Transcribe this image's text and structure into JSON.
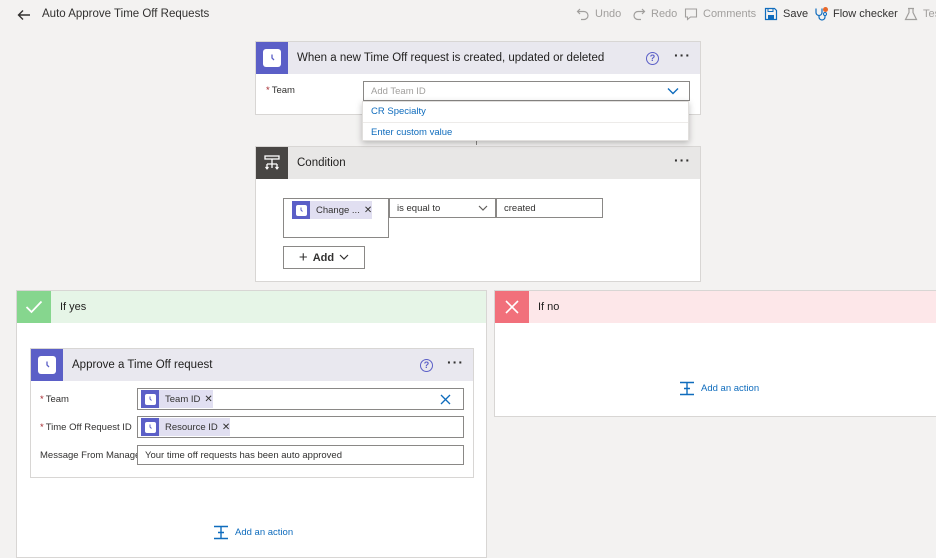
{
  "topbar": {
    "title": "Auto Approve Time Off Requests",
    "undo": "Undo",
    "redo": "Redo",
    "comments": "Comments",
    "save": "Save",
    "flow_checker": "Flow checker",
    "test": "Tes"
  },
  "trigger": {
    "title": "When a new Time Off request is created, updated or deleted",
    "team_label": "Team",
    "team_placeholder": "Add Team ID",
    "dropdown_options": [
      "CR Specialty",
      "Enter custom value"
    ]
  },
  "condition": {
    "title": "Condition",
    "left_token": "Change ...",
    "operator": "is equal to",
    "value": "created",
    "add_label": "Add"
  },
  "branch_yes": {
    "title": "If yes",
    "action": {
      "title": "Approve a Time Off request",
      "team_label": "Team",
      "team_token": "Team ID",
      "request_label": "Time Off Request ID",
      "request_token": "Resource ID",
      "message_label": "Message From Manager",
      "message_value": "Your time off requests has been auto approved"
    },
    "add_action": "Add an action"
  },
  "branch_no": {
    "title": "If no",
    "add_action": "Add an action"
  },
  "colors": {
    "teams_purple": "#5b5fc7",
    "yes_green": "#86d68e",
    "no_red": "#f1707b",
    "link_blue": "#0f6cbd"
  }
}
